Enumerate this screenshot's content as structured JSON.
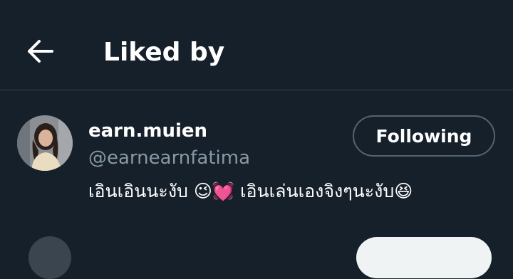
{
  "header": {
    "back_icon": "arrow-left-icon",
    "title": "Liked by"
  },
  "users": [
    {
      "display_name": "earn.muien",
      "handle": "@earnearnfatima",
      "bio": "เอินเอินนะงับ 😉💓 เอินเล่นเองจิงๆนะงับ😆",
      "follow_label": "Following",
      "avatar_icon": "user-avatar"
    }
  ],
  "colors": {
    "background": "#15202b",
    "divider": "#38444d",
    "secondary_text": "#8899a6",
    "button_border": "#536471"
  }
}
